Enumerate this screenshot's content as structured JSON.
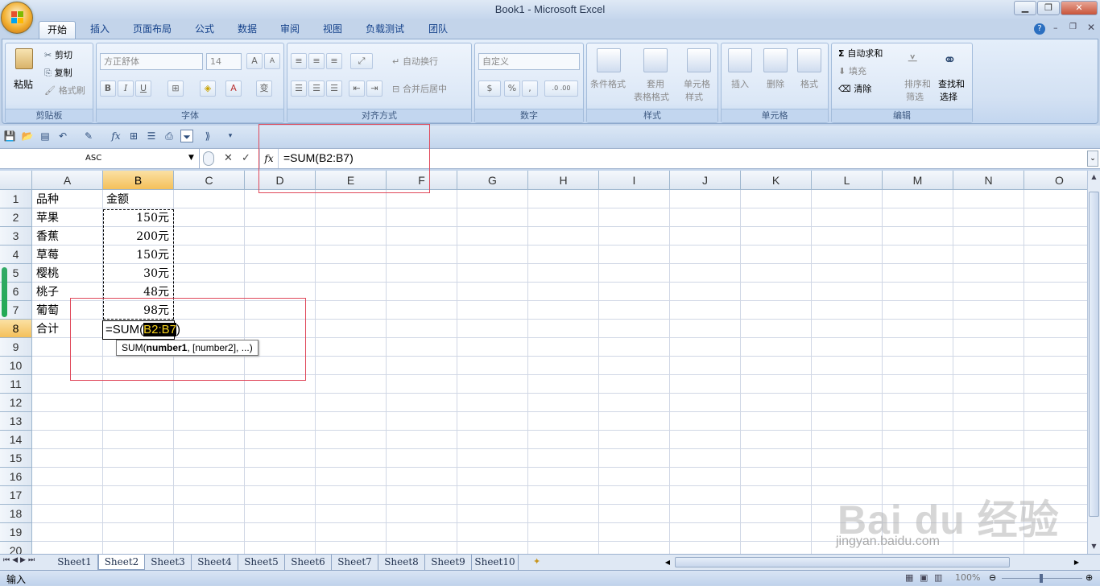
{
  "window": {
    "title": "Book1 - Microsoft Excel"
  },
  "tabs": [
    "开始",
    "插入",
    "页面布局",
    "公式",
    "数据",
    "审阅",
    "视图",
    "负载测试",
    "团队"
  ],
  "ribbon": {
    "clipboard": {
      "paste": "粘贴",
      "cut": "剪切",
      "copy": "复制",
      "format_painter": "格式刷",
      "label": "剪贴板"
    },
    "font": {
      "font_name": "方正舒体",
      "font_size": "14",
      "label": "字体",
      "bold": "B",
      "italic": "I",
      "underline": "U",
      "grow": "A",
      "shrink": "A",
      "font_color": "A",
      "phonetic": "变"
    },
    "alignment": {
      "wrap": "自动换行",
      "merge": "合并后居中",
      "label": "对齐方式"
    },
    "number": {
      "format": "自定义",
      "percent": "%",
      "comma": ",",
      "inc": ".0 .00",
      "label": "数字"
    },
    "styles": {
      "cond": "条件格式",
      "table1": "套用",
      "table2": "表格格式",
      "cell1": "单元格",
      "cell2": "样式",
      "label": "样式"
    },
    "cells": {
      "insert": "插入",
      "delete": "删除",
      "format": "格式",
      "label": "单元格"
    },
    "editing": {
      "autosum": "自动求和",
      "fill": "填充",
      "clear": "清除",
      "sort1": "排序和",
      "sort2": "筛选",
      "find1": "查找和",
      "find2": "选择",
      "label": "编辑"
    }
  },
  "formula_bar": {
    "name_box": "ASC",
    "cancel": "✕",
    "enter": "✓",
    "fx": "fx",
    "formula": "=SUM(B2:B7)"
  },
  "columns": [
    "A",
    "B",
    "C",
    "D",
    "E",
    "F",
    "G",
    "H",
    "I",
    "J",
    "K",
    "L",
    "M",
    "N",
    "O"
  ],
  "rows": [
    "1",
    "2",
    "3",
    "4",
    "5",
    "6",
    "7",
    "8",
    "9",
    "10",
    "11",
    "12",
    "13",
    "14",
    "15",
    "16",
    "17",
    "18",
    "19",
    "20"
  ],
  "cells": {
    "A": [
      "品种",
      "苹果",
      "香蕉",
      "草莓",
      "樱桃",
      "桃子",
      "葡萄",
      "合计"
    ],
    "B1": "金额",
    "B": [
      "150元",
      "200元",
      "150元",
      "30元",
      "48元",
      "98元"
    ],
    "B8_prefix": "=SUM(",
    "B8_ref": "B2:B7",
    "B8_suffix": ")"
  },
  "tooltip": {
    "fn": "SUM(",
    "arg1": "number1",
    "rest": ", [number2], ...)"
  },
  "sheets": [
    "Sheet1",
    "Sheet2",
    "Sheet3",
    "Sheet4",
    "Sheet5",
    "Sheet6",
    "Sheet7",
    "Sheet8",
    "Sheet9",
    "Sheet10"
  ],
  "status": {
    "mode": "输入",
    "zoom": "100%"
  },
  "watermark": {
    "brand": "Bai du 经验",
    "url": "jingyan.baidu.com"
  },
  "colors": {
    "accent": "#f4c05a",
    "annotation": "#e0485a",
    "ribbon": "#d3e1f3"
  }
}
